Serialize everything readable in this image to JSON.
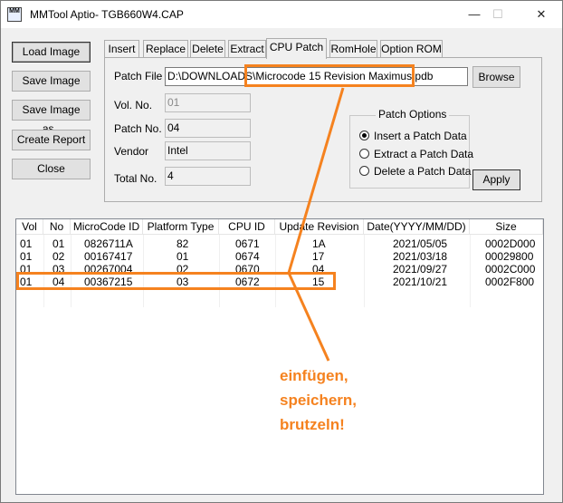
{
  "window": {
    "title": "MMTool Aptio- TGB660W4.CAP",
    "icon_label": "MM",
    "minimize": "—",
    "maximize": "☐",
    "close": "✕"
  },
  "left_buttons": [
    {
      "label": "Load Image"
    },
    {
      "label": "Save Image"
    },
    {
      "label": "Save Image as.."
    },
    {
      "label": "Create Report"
    },
    {
      "label": "Close"
    }
  ],
  "tabs": [
    {
      "label": "Insert"
    },
    {
      "label": "Replace"
    },
    {
      "label": "Delete"
    },
    {
      "label": "Extract"
    },
    {
      "label": "CPU Patch",
      "active": true
    },
    {
      "label": "RomHole"
    },
    {
      "label": "Option ROM"
    }
  ],
  "cpu_patch": {
    "patch_file_label": "Patch File",
    "patch_file_value": "D:\\DOWNLOADS\\Microcode 15 Revision Maximus.pdb",
    "browse_label": "Browse",
    "vol_no_label": "Vol. No.",
    "vol_no_value": "01",
    "patch_no_label": "Patch No.",
    "patch_no_value": "04",
    "vendor_label": "Vendor",
    "vendor_value": "Intel",
    "total_no_label": "Total No.",
    "total_no_value": "4",
    "options_title": "Patch Options",
    "options": [
      {
        "label": "Insert a Patch Data",
        "selected": true
      },
      {
        "label": "Extract a Patch Data",
        "selected": false
      },
      {
        "label": "Delete a Patch Data",
        "selected": false
      }
    ],
    "apply_label": "Apply"
  },
  "table": {
    "columns": [
      "Vol",
      "No",
      "MicroCode ID",
      "Platform Type",
      "CPU ID",
      "Update Revision",
      "Date(YYYY/MM/DD)",
      "Size"
    ],
    "rows": [
      [
        "01",
        "01",
        "0826711A",
        "82",
        "0671",
        "1A",
        "2021/05/05",
        "0002D000"
      ],
      [
        "01",
        "02",
        "00167417",
        "01",
        "0674",
        "17",
        "2021/03/18",
        "00029800"
      ],
      [
        "01",
        "03",
        "00267004",
        "02",
        "0670",
        "04",
        "2021/09/27",
        "0002C000"
      ],
      [
        "01",
        "04",
        "00367215",
        "03",
        "0672",
        "15",
        "2021/10/21",
        "0002F800"
      ]
    ]
  },
  "annotation": {
    "lines": [
      "einfügen,",
      "speichern,",
      "brutzeln!"
    ],
    "color": "#f5821f"
  }
}
